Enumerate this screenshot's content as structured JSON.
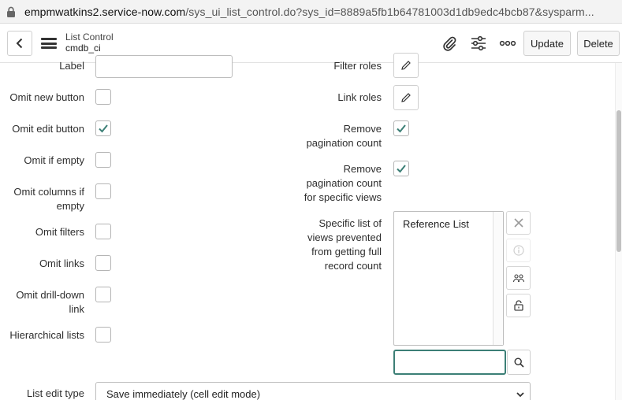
{
  "browser": {
    "url_host": "empmwatkins2.service-now.com",
    "url_rest": "/sys_ui_list_control.do?sys_id=8889a5fb1b64781003d1db9edc4bcb87&sysparm..."
  },
  "header": {
    "title": "List Control",
    "subtitle": "cmdb_ci",
    "update_label": "Update",
    "delete_label": "Delete",
    "icons": [
      "back-icon",
      "menu-icon",
      "attachment-icon",
      "settings-sliders-icon",
      "more-icon"
    ]
  },
  "left_fields": {
    "label": "Label",
    "omit_new_button": {
      "label": "Omit new button",
      "checked": false
    },
    "omit_edit_button": {
      "label": "Omit edit button",
      "checked": true
    },
    "omit_if_empty": {
      "label": "Omit if empty",
      "checked": false
    },
    "omit_columns_if_empty": {
      "label_line1": "Omit columns if",
      "label_line2": "empty",
      "checked": false
    },
    "omit_filters": {
      "label": "Omit filters",
      "checked": false
    },
    "omit_links": {
      "label": "Omit links",
      "checked": false
    },
    "omit_drill_down_link": {
      "label_line1": "Omit drill-down",
      "label_line2": "link",
      "checked": false
    },
    "hierarchical_lists": {
      "label": "Hierarchical lists",
      "checked": false
    }
  },
  "right_fields": {
    "filter_roles": "Filter roles",
    "link_roles": "Link roles",
    "remove_pagination_count": {
      "line1": "Remove",
      "line2": "pagination count",
      "checked": true
    },
    "remove_pagination_specific": {
      "line1": "Remove",
      "line2": "pagination count",
      "line3": "for specific views",
      "checked": true
    },
    "specific_list": {
      "line1": "Specific list of",
      "line2": "views prevented",
      "line3": "from getting full",
      "line4": "record count",
      "options": [
        "Reference List"
      ]
    }
  },
  "list_edit_type": {
    "label": "List edit type",
    "value": "Save immediately (cell edit mode)"
  },
  "colors": {
    "accent_check": "#3c7f76",
    "border": "#bdbdbd"
  }
}
